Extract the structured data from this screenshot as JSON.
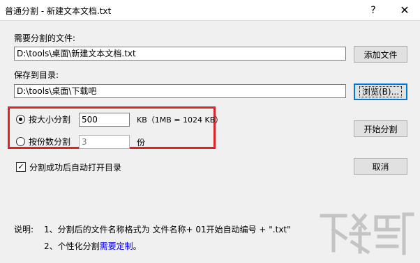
{
  "window": {
    "title": "普通分割 - 新建文本文档.txt",
    "help_glyph": "?",
    "close_glyph": "✕"
  },
  "source": {
    "label": "需要分割的文件:",
    "value": "D:\\tools\\桌面\\新建文本文档.txt",
    "button": "添加文件"
  },
  "target": {
    "label": "保存到目录:",
    "value": "D:\\tools\\桌面\\下载吧",
    "button": "浏览(B)..."
  },
  "split": {
    "by_size": {
      "label": "按大小分割",
      "value": "500",
      "unit": "KB（1MB = 1024 KB）",
      "selected": true
    },
    "by_count": {
      "label": "按份数分割",
      "value": "3",
      "unit": "份",
      "selected": false
    },
    "start_button": "开始分割"
  },
  "options": {
    "open_dir_label": "分割成功后自动打开目录",
    "open_dir_checked": true
  },
  "cancel_button": "取消",
  "notes": {
    "title": "说明:",
    "line1": "1、分割后的文件名称格式为   文件名称+ 01开始自动编号 + \".txt\"",
    "line2_prefix": "2、个性化分割",
    "line2_link": "需要定制",
    "line2_suffix": "。"
  },
  "colors": {
    "highlight_box": "#d9242a",
    "link": "#0000ee"
  }
}
